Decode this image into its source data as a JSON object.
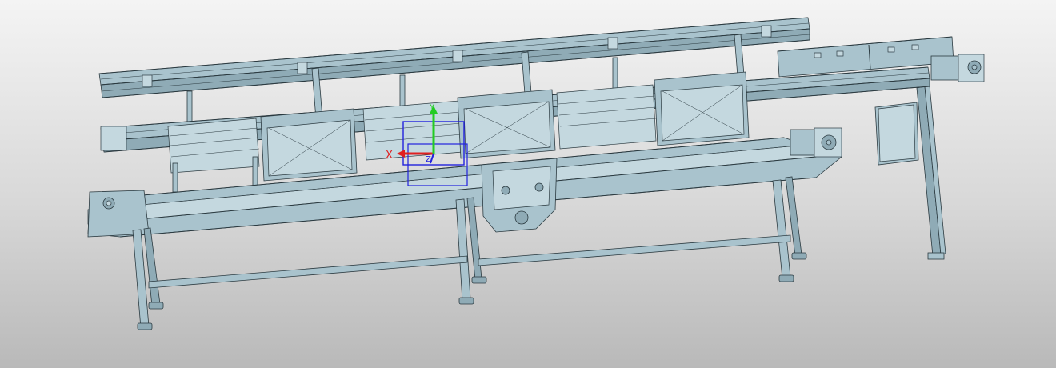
{
  "viewport": {
    "background_top": "#f4f4f4",
    "background_bottom": "#b9b9b9"
  },
  "model": {
    "fill_color": "#a9c3cd",
    "fill_dark": "#8fabb6",
    "fill_light": "#c4d8df",
    "edge_color": "#2b3a40"
  },
  "triad": {
    "x_label": "X",
    "y_label": "Y",
    "z_label": "Z",
    "x_color": "#e02020",
    "y_color": "#22cc22",
    "z_color": "#2222dd"
  }
}
